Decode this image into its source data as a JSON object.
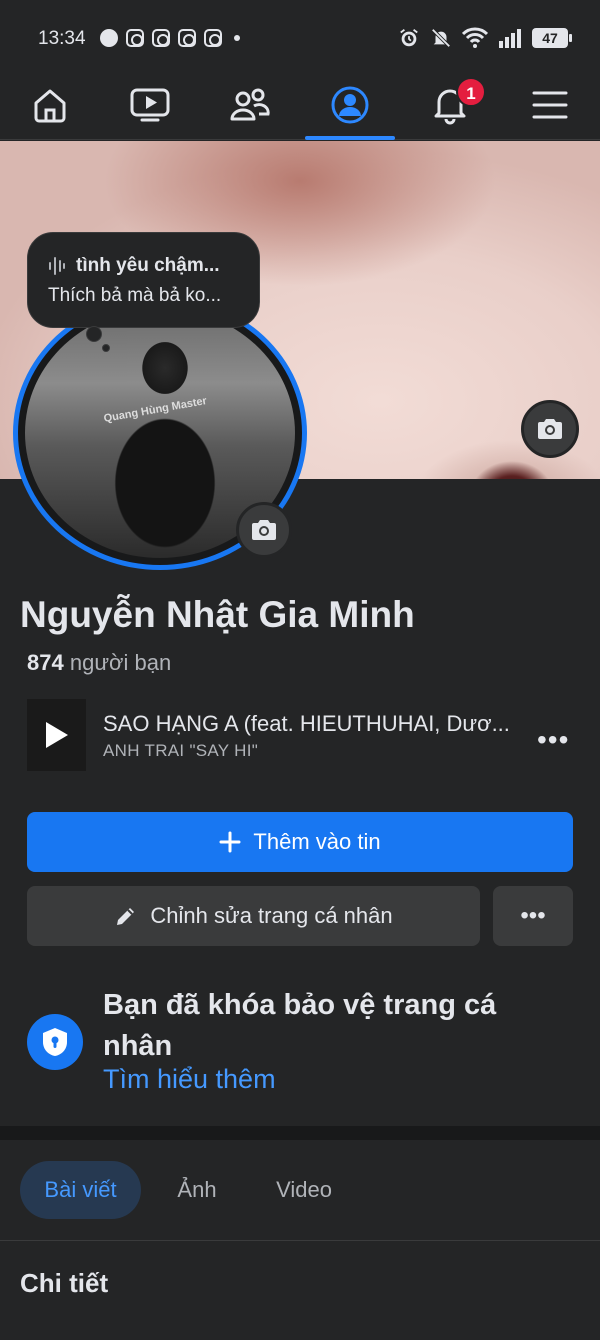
{
  "status_bar": {
    "time": "13:34",
    "battery": "47",
    "icons": [
      "messenger-icon",
      "instagram-icon",
      "instagram-icon",
      "instagram-icon",
      "instagram-icon",
      "dot-icon",
      "alarm-icon",
      "mute-bell-icon",
      "wifi-icon",
      "signal-icon",
      "battery-icon"
    ]
  },
  "nav": {
    "items": [
      "home-icon",
      "watch-icon",
      "friends-icon",
      "profile-icon",
      "notifications-icon",
      "menu-icon"
    ],
    "active": "profile-icon",
    "notification_count": "1"
  },
  "note": {
    "title": "tình yêu chậm...",
    "subtitle": "Thích bả mà bả ko..."
  },
  "avatar": {
    "shirt_text": "Quang Hùng Master"
  },
  "profile": {
    "name": "Nguyễn Nhật Gia Minh",
    "friend_count": "874",
    "friend_label": "người bạn"
  },
  "music": {
    "title": "SAO HẠNG A (feat. HIEUTHUHAI, Dươ...",
    "artist": "ANH TRAI \"SAY HI\"",
    "more": "•••"
  },
  "actions": {
    "add_story": "Thêm vào tin",
    "edit_profile": "Chỉnh sửa trang cá nhân",
    "more": "•••"
  },
  "lock_notice": {
    "text": "Bạn đã khóa bảo vệ trang cá nhân",
    "link": "Tìm hiểu thêm"
  },
  "tabs": [
    {
      "label": "Bài viết",
      "active": true
    },
    {
      "label": "Ảnh",
      "active": false
    },
    {
      "label": "Video",
      "active": false
    }
  ],
  "details": {
    "title": "Chi tiết"
  },
  "colors": {
    "accent": "#1877f2",
    "link": "#4599ff",
    "background": "#242526",
    "badge": "#e41e3f"
  }
}
